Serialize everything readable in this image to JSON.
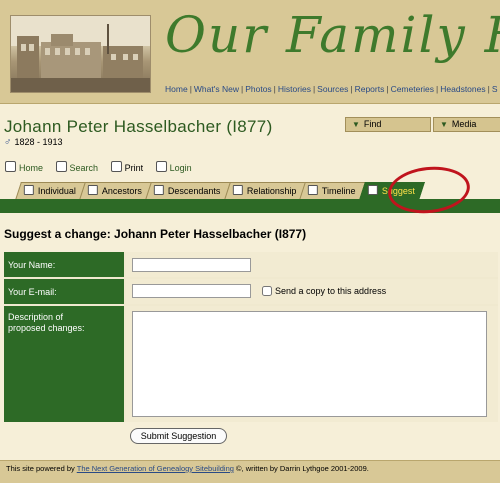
{
  "site": {
    "title": "Our Family H",
    "nav": [
      "Home",
      "What's New",
      "Photos",
      "Histories",
      "Sources",
      "Reports",
      "Cemeteries",
      "Headstones",
      "S"
    ]
  },
  "person": {
    "name": "Johann Peter Hasselbacher (I877)",
    "gender_symbol": "♂",
    "dates": "1828 - 1913"
  },
  "dropdowns": {
    "find": "Find",
    "media": "Media"
  },
  "util_links": {
    "home": "Home",
    "search": "Search",
    "print": "Print",
    "login": "Login"
  },
  "tabs": [
    {
      "label": "Individual"
    },
    {
      "label": "Ancestors"
    },
    {
      "label": "Descendants"
    },
    {
      "label": "Relationship"
    },
    {
      "label": "Timeline"
    },
    {
      "label": "Suggest",
      "active": true
    }
  ],
  "form": {
    "title": "Suggest a change: Johann Peter Hasselbacher (I877)",
    "name_label": "Your Name:",
    "email_label": "Your E-mail:",
    "copy_label": "Send a copy to this address",
    "desc_label_1": "Description of",
    "desc_label_2": "proposed changes:",
    "name_value": "",
    "email_value": "",
    "description_value": "",
    "submit_label": "Submit Suggestion"
  },
  "footer": {
    "prefix": "This site powered by ",
    "link": "The Next Generation of Genealogy Sitebuilding",
    "suffix": " ©, written by Darrin Lythgoe 2001-2009."
  },
  "colors": {
    "accent_green": "#2d6a26",
    "banner": "#d8c896",
    "active_tab_text": "#ffe24a",
    "highlight_circle": "#c0141d"
  }
}
